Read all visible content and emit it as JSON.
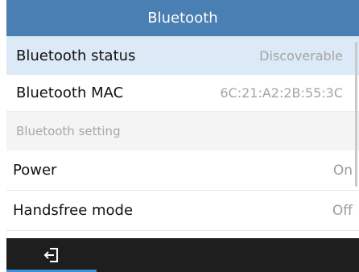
{
  "header": {
    "title": "Bluetooth"
  },
  "info_rows": [
    {
      "label": "Bluetooth status",
      "value": "Discoverable"
    },
    {
      "label": "Bluetooth MAC",
      "value": "6C:21:A2:2B:55:3C"
    }
  ],
  "section": {
    "title": "Bluetooth setting"
  },
  "settings": [
    {
      "label": "Power",
      "value": "On"
    },
    {
      "label": "Handsfree mode",
      "value": "Off"
    }
  ],
  "softkeys": {
    "back_icon": "exit-arrow-icon"
  },
  "colors": {
    "title_bar": "#4a7fb4",
    "selected_row": "#dbeaf6",
    "softkey_bar": "#1e1e1e",
    "accent": "#3a8fd8"
  }
}
